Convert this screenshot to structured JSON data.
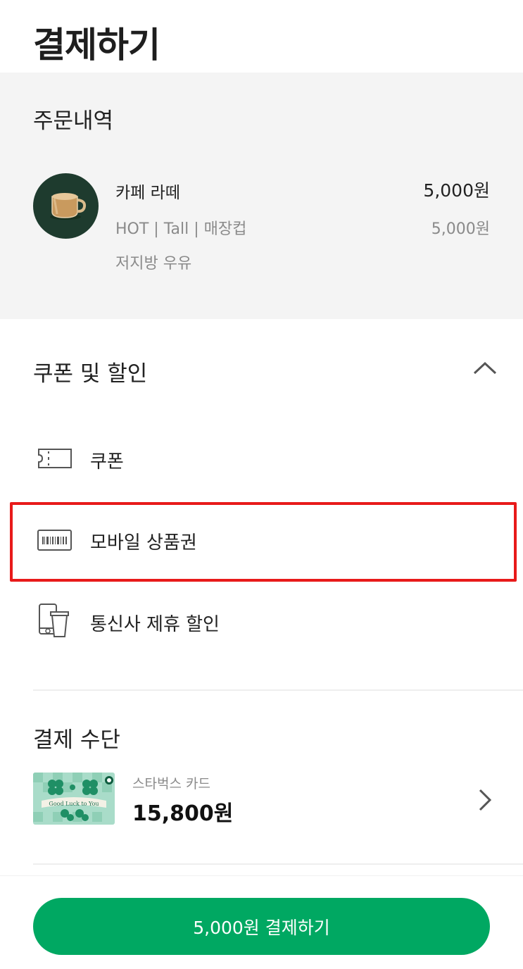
{
  "header": {
    "title": "결제하기"
  },
  "order": {
    "heading": "주문내역",
    "item": {
      "name": "카페 라떼",
      "price": "5,000원",
      "options": "HOT | Tall | 매장컵",
      "subprice": "5,000원",
      "milk": "저지방 우유",
      "thumbnail_icon": "latte-mug-icon"
    }
  },
  "discounts": {
    "heading": "쿠폰 및 할인",
    "toggle_icon": "chevron-up-icon",
    "items": [
      {
        "label": "쿠폰",
        "icon": "ticket-icon"
      },
      {
        "label": "모바일 상품권",
        "icon": "barcode-card-icon"
      },
      {
        "label": "통신사 제휴 할인",
        "icon": "phone-cup-icon"
      }
    ]
  },
  "payment": {
    "heading": "결제 수단",
    "card": {
      "name": "스타벅스 카드",
      "balance": "15,800원",
      "card_text": "Good Luck to You"
    }
  },
  "footer": {
    "pay_button_label": "5,000원 결제하기"
  },
  "colors": {
    "accent_green": "#00a862",
    "highlight_red": "#e81a1a",
    "section_bg": "#f4f4f4",
    "muted_text": "#8a8a8a"
  }
}
